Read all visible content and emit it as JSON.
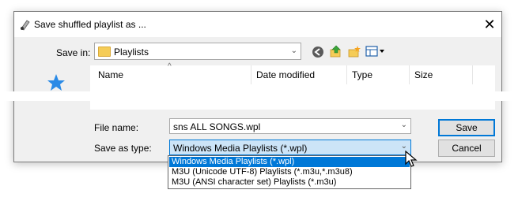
{
  "dialog": {
    "title": "Save shuffled playlist as ...",
    "close_glyph": "✕"
  },
  "save_in": {
    "label": "Save in:",
    "value": "Playlists"
  },
  "toolbar": {
    "icons": [
      "back-icon",
      "up-folder-icon",
      "new-folder-icon",
      "view-menu-icon"
    ]
  },
  "file_list": {
    "columns": [
      "Name",
      "Date modified",
      "Type",
      "Size"
    ]
  },
  "file_name": {
    "label": "File name:",
    "value": "sns ALL SONGS.wpl"
  },
  "save_as_type": {
    "label": "Save as type:",
    "value": "Windows Media Playlists (*.wpl)",
    "options": [
      "Windows Media Playlists (*.wpl)",
      "M3U (Unicode UTF-8) Playlists (*.m3u,*.m3u8)",
      "M3U (ANSI character set) Playlists (*.m3u)"
    ],
    "selected_index": 0
  },
  "buttons": {
    "save": "Save",
    "cancel": "Cancel"
  },
  "colors": {
    "selection": "#0078d7",
    "dialog_bg": "#f0f0f0",
    "folder": "#f5cc57"
  }
}
